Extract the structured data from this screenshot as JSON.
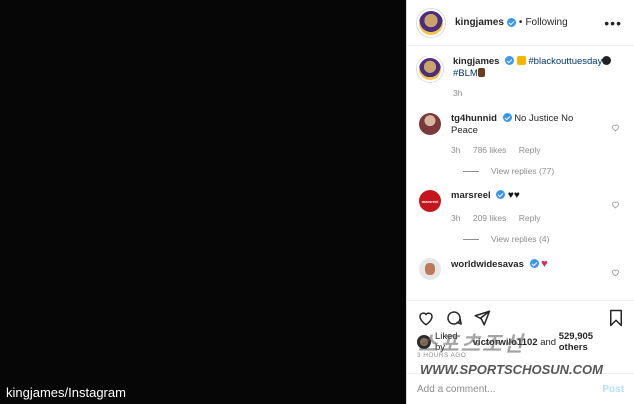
{
  "credit": "kingjames/Instagram",
  "header": {
    "username": "kingjames",
    "separator": "•",
    "follow_status": "Following",
    "more": "•••"
  },
  "caption": {
    "username": "kingjames",
    "hashtag1": "#blackouttuesday",
    "hashtag2": "#BLM",
    "time": "3h"
  },
  "comments": [
    {
      "username": "tg4hunnid",
      "text": "No Justice No Peace",
      "time": "3h",
      "likes": "786 likes",
      "reply": "Reply",
      "view_replies": "View replies (77)"
    },
    {
      "username": "marsreel",
      "avatar_text": "marsreel",
      "time": "3h",
      "likes": "209 likes",
      "reply": "Reply",
      "view_replies": "View replies (4)"
    },
    {
      "username": "worldwidesavas"
    }
  ],
  "likes": {
    "prefix": "Liked by ",
    "user": "victorwilo1102",
    "middle": " and ",
    "count": "529,905 others"
  },
  "timestamp": "3 HOURS AGO",
  "add_comment": {
    "placeholder": "Add a comment...",
    "post_label": "Post"
  },
  "watermark": {
    "line1": "스포츠조선",
    "line2": "WWW.SPORTSCHOSUN.COM"
  },
  "icons": [
    "heart-icon",
    "comment-icon",
    "share-icon",
    "bookmark-icon",
    "more-icon",
    "verified-icon"
  ],
  "colors": {
    "verified": "#3897f0",
    "link": "#00376b",
    "muted": "#8e8e8e",
    "post_disabled": "#b2dffc"
  }
}
